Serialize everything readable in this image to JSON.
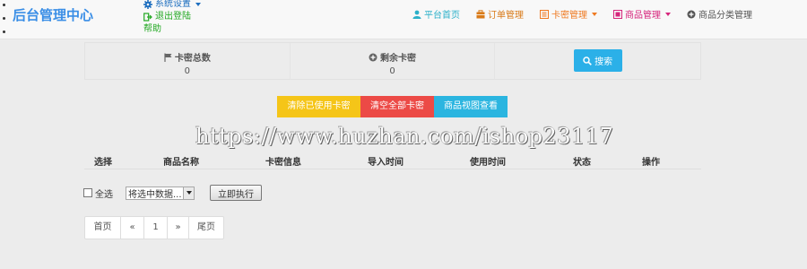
{
  "brand": "后台管理中心",
  "user_menu": {
    "settings_label": "系统设置",
    "logout_label": "退出登陆",
    "help_label": "帮助"
  },
  "nav": [
    {
      "label": "平台首页",
      "icon": "user-icon",
      "color": "#2bb0c9",
      "dropdown": false
    },
    {
      "label": "订单管理",
      "icon": "briefcase-icon",
      "color": "#d97a18",
      "dropdown": false
    },
    {
      "label": "卡密管理",
      "icon": "list-icon",
      "color": "#ef7a22",
      "dropdown": true
    },
    {
      "label": "商品管理",
      "icon": "grid-icon",
      "color": "#d6257c",
      "dropdown": true
    },
    {
      "label": "商品分类管理",
      "icon": "plus-circle-icon",
      "color": "#555555",
      "dropdown": false
    }
  ],
  "stats": {
    "total_label": "卡密总数",
    "total_value": "0",
    "remaining_label": "剩余卡密",
    "remaining_value": "0",
    "search_label": "搜索"
  },
  "actions": {
    "clear_used": "清除已使用卡密",
    "clear_all": "清空全部卡密",
    "product_view": "商品视图查看"
  },
  "watermark": "https://www.huzhan.com/ishop23117",
  "table": {
    "columns": [
      "选择",
      "商品名称",
      "卡密信息",
      "导入时间",
      "使用时间",
      "状态",
      "操作"
    ]
  },
  "bulk": {
    "select_all": "全选",
    "select_value": "将选中数据...",
    "execute": "立即执行"
  },
  "pagination": [
    "首页",
    "«",
    "1",
    "»",
    "尾页"
  ],
  "colors": {
    "brand": "#3a8ee6",
    "search": "#2bb0e8",
    "btn_yellow": "#f5c518",
    "btn_red": "#ec4a46",
    "btn_blue": "#2bb5e0"
  }
}
